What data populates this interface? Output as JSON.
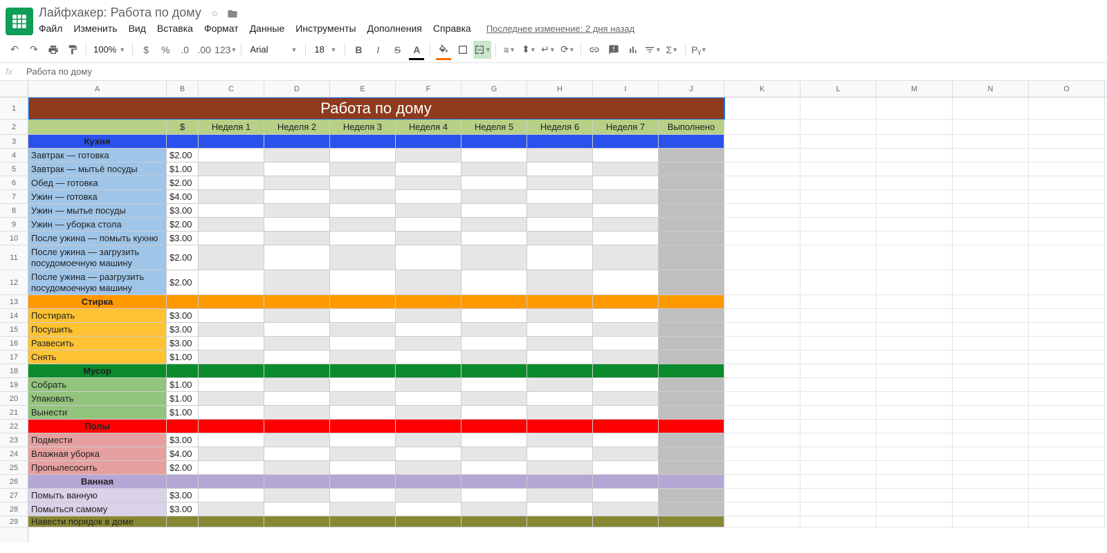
{
  "doc_title": "Лайфхакер: Работа по дому",
  "menus": [
    "Файл",
    "Изменить",
    "Вид",
    "Вставка",
    "Формат",
    "Данные",
    "Инструменты",
    "Дополнения",
    "Справка"
  ],
  "last_edit": "Последнее изменение: 2 дня назад",
  "zoom": "100%",
  "font": "Arial",
  "font_size": "18",
  "fx_value": "Работа по дому",
  "cols": [
    "A",
    "B",
    "C",
    "D",
    "E",
    "F",
    "G",
    "H",
    "I",
    "J",
    "K",
    "L",
    "M",
    "N",
    "O"
  ],
  "headers": {
    "dollar": "$",
    "w1": "Неделя 1",
    "w2": "Неделя 2",
    "w3": "Неделя 3",
    "w4": "Неделя 4",
    "w5": "Неделя 5",
    "w6": "Неделя 6",
    "w7": "Неделя 7",
    "done": "Выполнено"
  },
  "sections": [
    {
      "name": "Кухня",
      "hdr_bg": "#2952ed",
      "task_bg": "#9fc5e8",
      "tasks": [
        {
          "t": "Завтрак — готовка",
          "p": "$2.00"
        },
        {
          "t": "Завтрак — мытьё посуды",
          "p": "$1.00"
        },
        {
          "t": "Обед — готовка",
          "p": "$2.00"
        },
        {
          "t": "Ужин — готовка",
          "p": "$4.00"
        },
        {
          "t": "Ужин — мытье посуды",
          "p": "$3.00"
        },
        {
          "t": "Ужин — уборка стола",
          "p": "$2.00"
        },
        {
          "t": "После ужина — помыть кухню",
          "p": "$3.00"
        },
        {
          "t": "После ужина — загрузить посудомоечную машину",
          "p": "$2.00",
          "tall": true
        },
        {
          "t": "После ужина — разгрузить посудомоечную машину",
          "p": "$2.00",
          "tall": true
        }
      ]
    },
    {
      "name": "Стирка",
      "hdr_bg": "#ff9900",
      "task_bg": "#ffc233",
      "tasks": [
        {
          "t": "Постирать",
          "p": "$3.00"
        },
        {
          "t": "Посушить",
          "p": "$3.00"
        },
        {
          "t": "Развесить",
          "p": "$3.00"
        },
        {
          "t": "Снять",
          "p": "$1.00"
        }
      ]
    },
    {
      "name": "Мусор",
      "hdr_bg": "#0b8b2c",
      "task_bg": "#93c47d",
      "tasks": [
        {
          "t": "Собрать",
          "p": "$1.00"
        },
        {
          "t": "Упаковать",
          "p": "$1.00"
        },
        {
          "t": "Вынести",
          "p": "$1.00"
        }
      ]
    },
    {
      "name": "Полы",
      "hdr_bg": "#ff0000",
      "task_bg": "#e6a0a0",
      "tasks": [
        {
          "t": "Подмести",
          "p": "$3.00"
        },
        {
          "t": "Влажная уборка",
          "p": "$4.00"
        },
        {
          "t": "Пропылесосить",
          "p": "$2.00"
        }
      ]
    },
    {
      "name": "Ванная",
      "hdr_bg": "#b4a7d6",
      "task_bg": "#d9d2e9",
      "tasks": [
        {
          "t": "Помыть ванную",
          "p": "$3.00"
        },
        {
          "t": "Помыться самому",
          "p": "$3.00"
        }
      ]
    }
  ],
  "last_partial_row": "Навести порядок в доме",
  "title_cell": "Работа по дому"
}
